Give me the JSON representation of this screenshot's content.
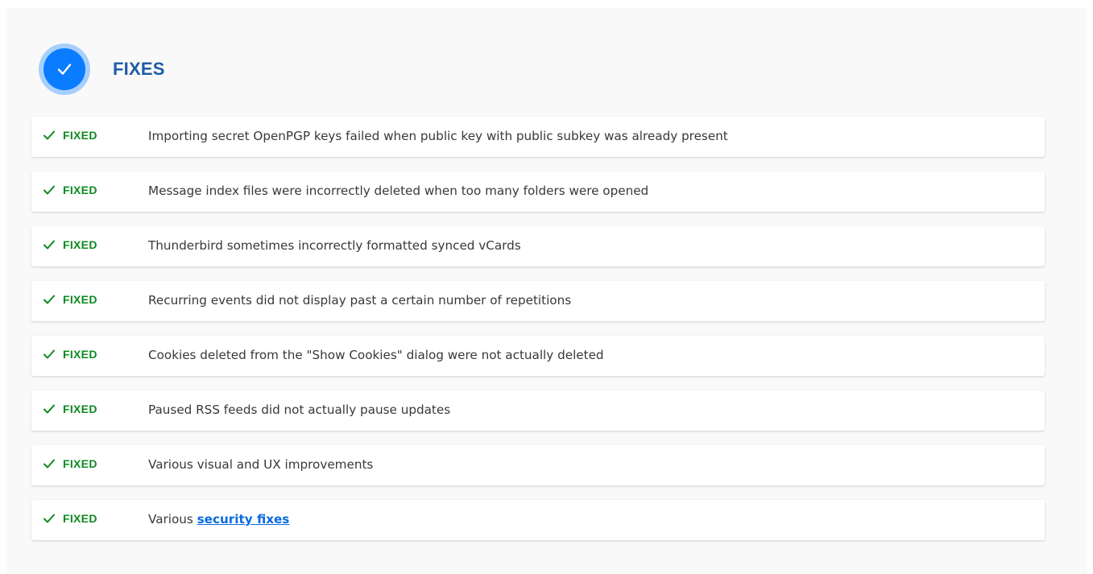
{
  "section": {
    "title": "FIXES",
    "icon": "check-circle-icon"
  },
  "colors": {
    "title": "#1f5da3",
    "icon_ring": "#a6d0fb",
    "icon_fill": "#0a7cff",
    "tag": "#0d8a1f",
    "link": "#0a6be0"
  },
  "fixes": [
    {
      "tag": "FIXED",
      "text": "Importing secret OpenPGP keys failed when public key with public subkey was already present"
    },
    {
      "tag": "FIXED",
      "text": "Message index files were incorrectly deleted when too many folders were opened"
    },
    {
      "tag": "FIXED",
      "text": "Thunderbird sometimes incorrectly formatted synced vCards"
    },
    {
      "tag": "FIXED",
      "text": "Recurring events did not display past a certain number of repetitions"
    },
    {
      "tag": "FIXED",
      "text": "Cookies deleted from the \"Show Cookies\" dialog were not actually deleted"
    },
    {
      "tag": "FIXED",
      "text": "Paused RSS feeds did not actually pause updates"
    },
    {
      "tag": "FIXED",
      "text": "Various visual and UX improvements"
    },
    {
      "tag": "FIXED",
      "text": "Various ",
      "link_text": "security fixes"
    }
  ]
}
